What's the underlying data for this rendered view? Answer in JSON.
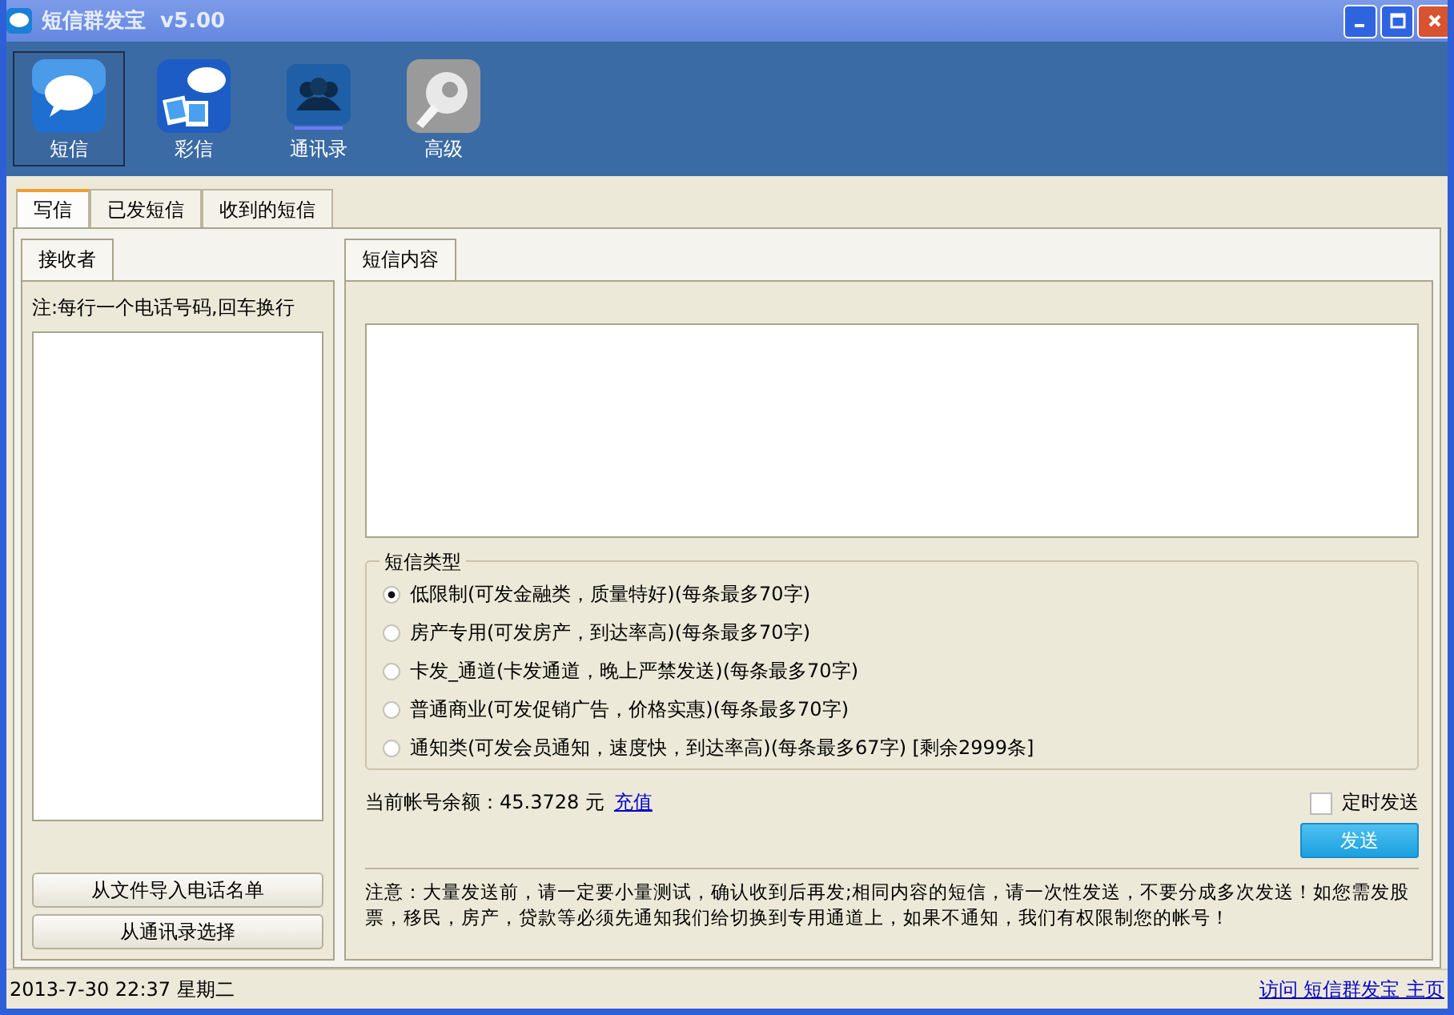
{
  "window": {
    "title": "短信群发宝  v5.00"
  },
  "toolbar": {
    "items": [
      {
        "kind": "sms",
        "label": "短信",
        "selected": true
      },
      {
        "kind": "mms",
        "label": "彩信",
        "selected": false
      },
      {
        "kind": "contacts",
        "label": "通讯录",
        "selected": false
      },
      {
        "kind": "settings",
        "label": "高级",
        "selected": false
      }
    ]
  },
  "tabs": [
    {
      "label": "写信",
      "selected": true
    },
    {
      "label": "已发短信",
      "selected": false
    },
    {
      "label": "收到的短信",
      "selected": false
    }
  ],
  "recipients": {
    "tab": "接收者",
    "note": "注:每行一个电话号码,回车换行",
    "buttons": [
      "从文件导入电话名单",
      "从通讯录选择"
    ]
  },
  "message": {
    "tab": "短信内容",
    "sms_type": {
      "legend": "短信类型",
      "options": [
        {
          "label": "低限制(可发金融类，质量特好)(每条最多70字)",
          "selected": true
        },
        {
          "label": "房产专用(可发房产，到达率高)(每条最多70字)",
          "selected": false
        },
        {
          "label": "卡发_通道(卡发通道，晚上严禁发送)(每条最多70字)",
          "selected": false
        },
        {
          "label": "普通商业(可发促销广告，价格实惠)(每条最多70字)",
          "selected": false
        },
        {
          "label": "通知类(可发会员通知，速度快，到达率高)(每条最多67字) [剩余2999条]",
          "selected": false
        }
      ]
    },
    "balance": "当前帐号余额：45.3728 元",
    "recharge_link": "充值",
    "scheduled": {
      "label": "定时发送",
      "checked": false
    },
    "send_button": "发送",
    "notice": "注意：大量发送前，请一定要小量测试，确认收到后再发;相同内容的短信，请一次性发送，不要分成多次发送！如您需发股票，移民，房产，贷款等必须先通知我们给切换到专用通道上，如果不通知，我们有权限制您的帐号！"
  },
  "status_bar": {
    "datetime": "2013-7-30 22:37 星期二",
    "link": "访问 短信群发宝 主页"
  }
}
